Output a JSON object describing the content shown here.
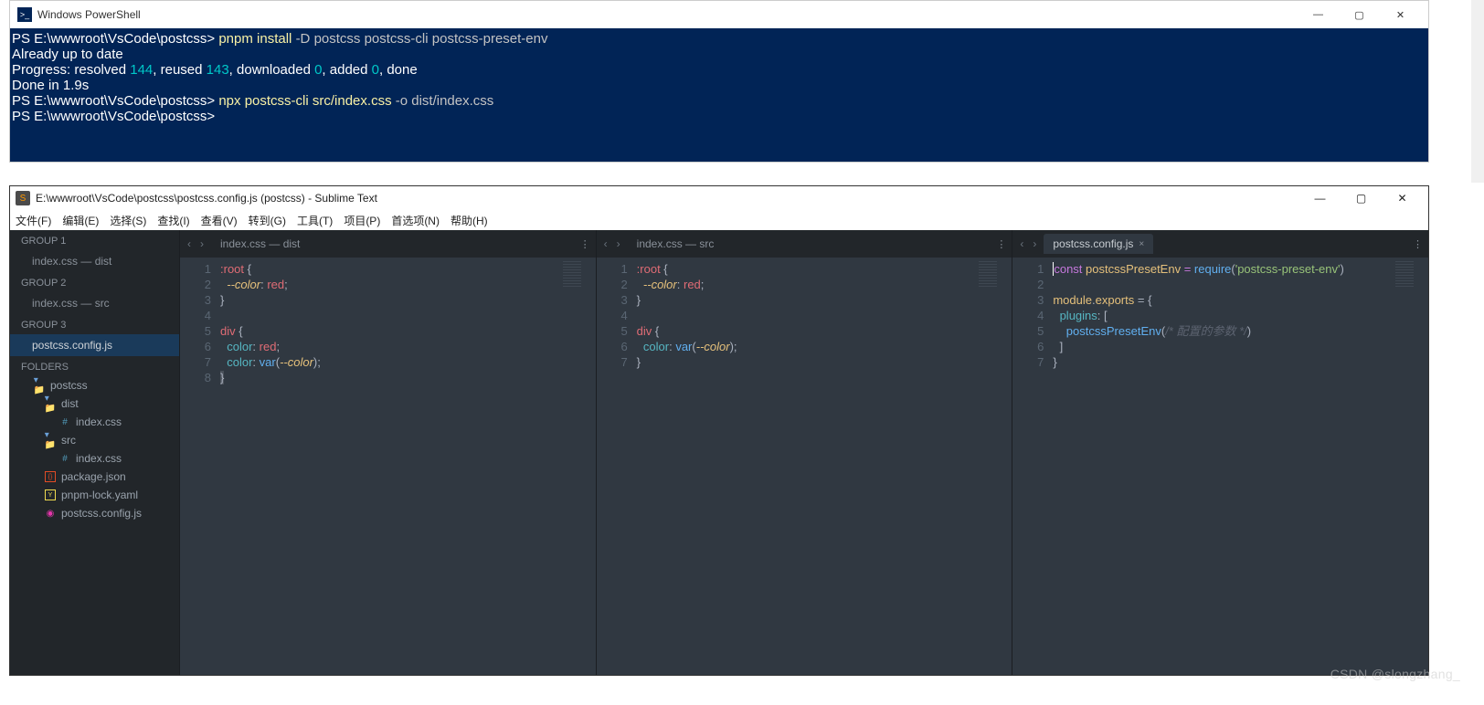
{
  "powershell": {
    "title": "Windows PowerShell",
    "lines": {
      "p1": "PS E:\\wwwroot\\VsCode\\postcss> ",
      "c1": "pnpm install ",
      "f1": "-D ",
      "a1": "postcss postcss-cli postcss-preset-env",
      "l2": "Already up to date",
      "l3a": "Progress: resolved ",
      "n1": "144",
      "l3b": ", reused ",
      "n2": "143",
      "l3c": ", downloaded ",
      "n3": "0",
      "l3d": ", added ",
      "n4": "0",
      "l3e": ", done",
      "l4": "Done in 1.9s",
      "p2": "PS E:\\wwwroot\\VsCode\\postcss> ",
      "c2": "npx postcss-cli src/index.css ",
      "f2": "-o ",
      "a2": "dist/index.css",
      "p3": "PS E:\\wwwroot\\VsCode\\postcss>"
    }
  },
  "sublime": {
    "title": "E:\\wwwroot\\VsCode\\postcss\\postcss.config.js (postcss) - Sublime Text",
    "menu": {
      "file": "文件(F)",
      "edit": "编辑(E)",
      "select": "选择(S)",
      "find": "查找(I)",
      "view": "查看(V)",
      "goto": "转到(G)",
      "tools": "工具(T)",
      "project": "项目(P)",
      "prefs": "首选项(N)",
      "help": "帮助(H)"
    },
    "sidebar": {
      "g1": "GROUP 1",
      "g1i": "index.css — dist",
      "g2": "GROUP 2",
      "g2i": "index.css — src",
      "g3": "GROUP 3",
      "g3i": "postcss.config.js",
      "folders": "FOLDERS",
      "tree": {
        "root": "postcss",
        "dist": "dist",
        "distcss": "index.css",
        "src": "src",
        "srccss": "index.css",
        "pkg": "package.json",
        "lock": "pnpm-lock.yaml",
        "cfg": "postcss.config.js"
      }
    },
    "panes": {
      "p1": {
        "tab": "index.css — dist",
        "ln": [
          "1",
          "2",
          "3",
          "4",
          "5",
          "6",
          "7",
          "8"
        ],
        "l1a": ":root",
        "l1b": " {",
        "l2a": "--color",
        "l2b": ": ",
        "l2c": "red",
        "l2d": ";",
        "l3": "}",
        "l4": "",
        "l5a": "div",
        "l5b": " {",
        "l6a": "color",
        "l6b": ": ",
        "l6c": "red",
        "l6d": ";",
        "l7a": "color",
        "l7b": ": ",
        "l7c": "var",
        "l7d": "(",
        "l7e": "--color",
        "l7f": ");",
        "l8": "}"
      },
      "p2": {
        "tab": "index.css — src",
        "ln": [
          "1",
          "2",
          "3",
          "4",
          "5",
          "6",
          "7"
        ],
        "l1a": ":root",
        "l1b": " {",
        "l2a": "--color",
        "l2b": ": ",
        "l2c": "red",
        "l2d": ";",
        "l3": "}",
        "l4": "",
        "l5a": "div",
        "l5b": " {",
        "l6a": "color",
        "l6b": ": ",
        "l6c": "var",
        "l6d": "(",
        "l6e": "--color",
        "l6f": ");",
        "l7": "}"
      },
      "p3": {
        "tab": "postcss.config.js",
        "close": "×",
        "ln": [
          "1",
          "2",
          "3",
          "4",
          "5",
          "6",
          "7"
        ],
        "l1a": "const",
        "l1b": " postcssPresetEnv ",
        "l1c": "=",
        "l1d": " require",
        "l1e": "(",
        "l1f": "'postcss-preset-env'",
        "l1g": ")",
        "l2": "",
        "l3a": "module",
        "l3b": ".",
        "l3c": "exports",
        "l3d": " = {",
        "l4a": "plugins",
        "l4b": ": [",
        "l5a": "postcssPresetEnv",
        "l5b": "(",
        "l5c": "/* 配置的参数 */",
        "l5d": ")",
        "l6": "]",
        "l7": "}"
      }
    }
  },
  "watermark": "CSDN @slongzhang_"
}
